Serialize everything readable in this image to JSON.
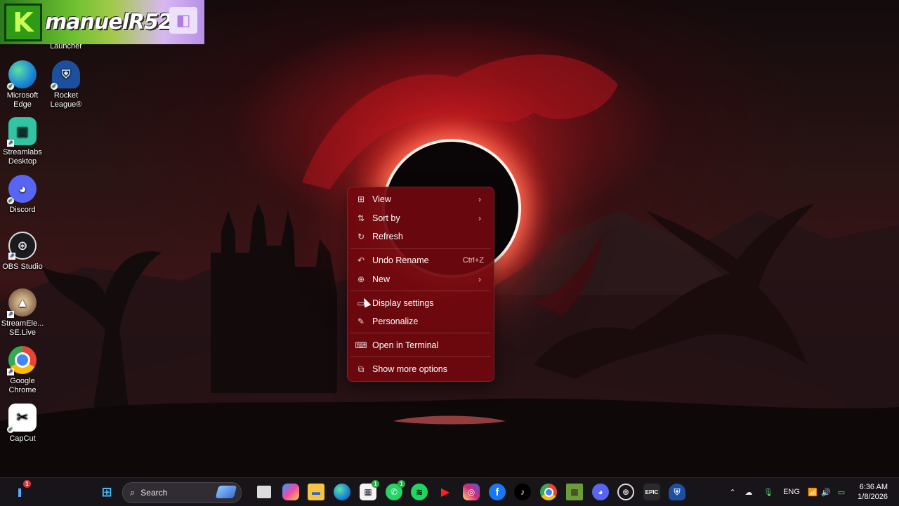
{
  "banner": {
    "text": "manuelR520"
  },
  "desktop_icons": [
    {
      "label": "Launcher"
    },
    {
      "label": "Microsoft Edge"
    },
    {
      "label": "Rocket League®"
    },
    {
      "label": "Streamlabs Desktop"
    },
    {
      "label": "Discord"
    },
    {
      "label": "OBS Studio"
    },
    {
      "label": "StreamEle... SE.Live"
    },
    {
      "label": "Google Chrome"
    },
    {
      "label": "CapCut"
    }
  ],
  "context_menu": {
    "items": [
      {
        "label": "View",
        "icon": "grid-icon",
        "has_submenu": true
      },
      {
        "label": "Sort by",
        "icon": "sort-icon",
        "has_submenu": true
      },
      {
        "label": "Refresh",
        "icon": "refresh-icon"
      },
      {
        "label": "Undo Rename",
        "icon": "undo-icon",
        "shortcut": "Ctrl+Z"
      },
      {
        "label": "New",
        "icon": "plus-circle-icon",
        "has_submenu": true
      },
      {
        "label": "Display settings",
        "icon": "display-icon"
      },
      {
        "label": "Personalize",
        "icon": "brush-icon"
      },
      {
        "label": "Open in Terminal",
        "icon": "terminal-icon"
      },
      {
        "label": "Show more options",
        "icon": "more-options-icon"
      }
    ]
  },
  "taskbar": {
    "search_placeholder": "Search",
    "widget_badge": "1",
    "store_badge": "1",
    "whatsapp_badge": "1",
    "language": "ENG",
    "time": "6:36 AM",
    "date": "1/8/2026"
  },
  "colors": {
    "menu_bg": "#70080e",
    "taskbar_bg": "#18161a",
    "accent_red": "#c8141e"
  }
}
